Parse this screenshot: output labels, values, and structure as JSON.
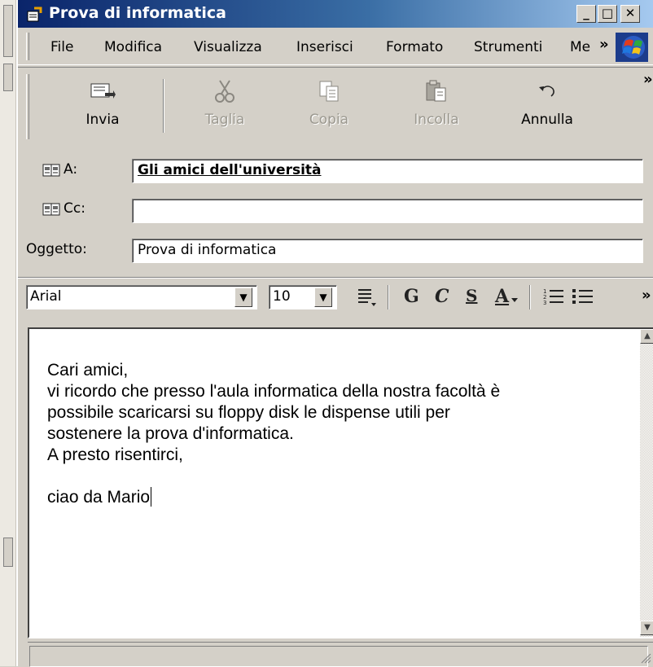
{
  "window": {
    "title": "Prova di informatica",
    "controls": {
      "minimize": "_",
      "maximize": "□",
      "close": "✕"
    }
  },
  "menubar": {
    "items": [
      "File",
      "Modifica",
      "Visualizza",
      "Inserisci",
      "Formato",
      "Strumenti",
      "Me"
    ],
    "overflow": "»"
  },
  "toolbar": {
    "send_label": "Invia",
    "cut_label": "Taglia",
    "copy_label": "Copia",
    "paste_label": "Incolla",
    "undo_label": "Annulla",
    "overflow": "»"
  },
  "header": {
    "to_label": "A:",
    "to_value": "Gli amici dell'università",
    "cc_label": "Cc:",
    "cc_value": "",
    "subject_label": "Oggetto:",
    "subject_value": "Prova di informatica"
  },
  "format": {
    "font": "Arial",
    "size": "10",
    "bold": "G",
    "italic": "C",
    "underline": "S",
    "color": "A",
    "overflow": "»"
  },
  "message": {
    "lines": [
      "Cari amici,",
      "vi ricordo che presso l'aula informatica della nostra facoltà è",
      "possibile scaricarsi su floppy disk le dispense utili per",
      "sostenere la prova d'informatica.",
      "A presto risentirci,",
      "",
      "ciao da Mario"
    ]
  },
  "colors": {
    "titlebar_start": "#0a246a",
    "titlebar_end": "#a6caf0",
    "chrome": "#d4d0c8",
    "disabled_text": "#9b988f"
  }
}
